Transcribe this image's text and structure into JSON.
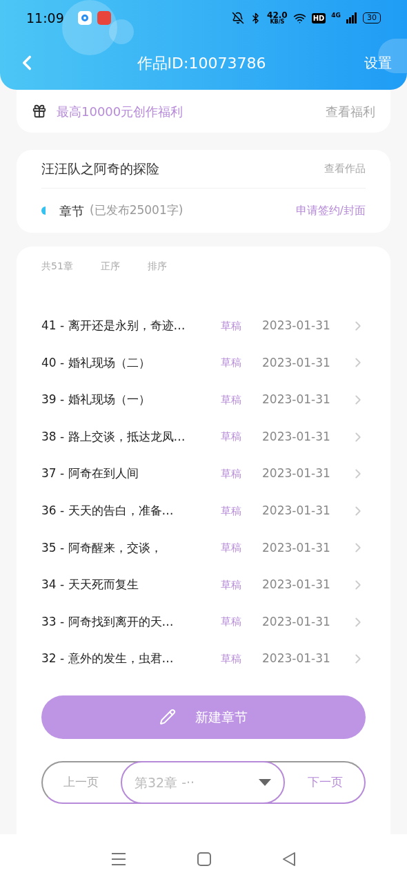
{
  "status_bar": {
    "time": "11:09",
    "speed": "42.0",
    "speed_unit": "KB/S",
    "hd": "HD",
    "network": "4G",
    "battery": "30"
  },
  "header": {
    "title": "作品ID:10073786",
    "action": "设置"
  },
  "promo": {
    "text": "最高10000元创作福利",
    "link": "查看福利"
  },
  "work": {
    "title": "汪汪队之阿奇的探险",
    "link": "查看作品",
    "section": "章节",
    "section_detail": "(已发布25001字)",
    "sign_link": "申请签约/封面"
  },
  "chapters": {
    "count": "共51章",
    "order": "正序",
    "sort": "排序",
    "rows": [
      {
        "title": "41 - 离开还是永别，奇迹…",
        "status": "草稿",
        "date": "2023-01-31"
      },
      {
        "title": "40 - 婚礼现场（二）",
        "status": "草稿",
        "date": "2023-01-31"
      },
      {
        "title": "39 - 婚礼现场（一）",
        "status": "草稿",
        "date": "2023-01-31"
      },
      {
        "title": "38 - 路上交谈，抵达龙凤…",
        "status": "草稿",
        "date": "2023-01-31"
      },
      {
        "title": "37 - 阿奇在到人间",
        "status": "草稿",
        "date": "2023-01-31"
      },
      {
        "title": "36 - 天天的告白，准备…",
        "status": "草稿",
        "date": "2023-01-31"
      },
      {
        "title": "35 - 阿奇醒来，交谈，",
        "status": "草稿",
        "date": "2023-01-31"
      },
      {
        "title": "34 - 天天死而复生",
        "status": "草稿",
        "date": "2023-01-31"
      },
      {
        "title": "33 - 阿奇找到离开的天…",
        "status": "草稿",
        "date": "2023-01-31"
      },
      {
        "title": "32 - 意外的发生，虫君…",
        "status": "草稿",
        "date": "2023-01-31"
      }
    ]
  },
  "new_button": "新建章节",
  "pager": {
    "prev": "上一页",
    "select": "第32章 -··",
    "next": "下一页"
  }
}
